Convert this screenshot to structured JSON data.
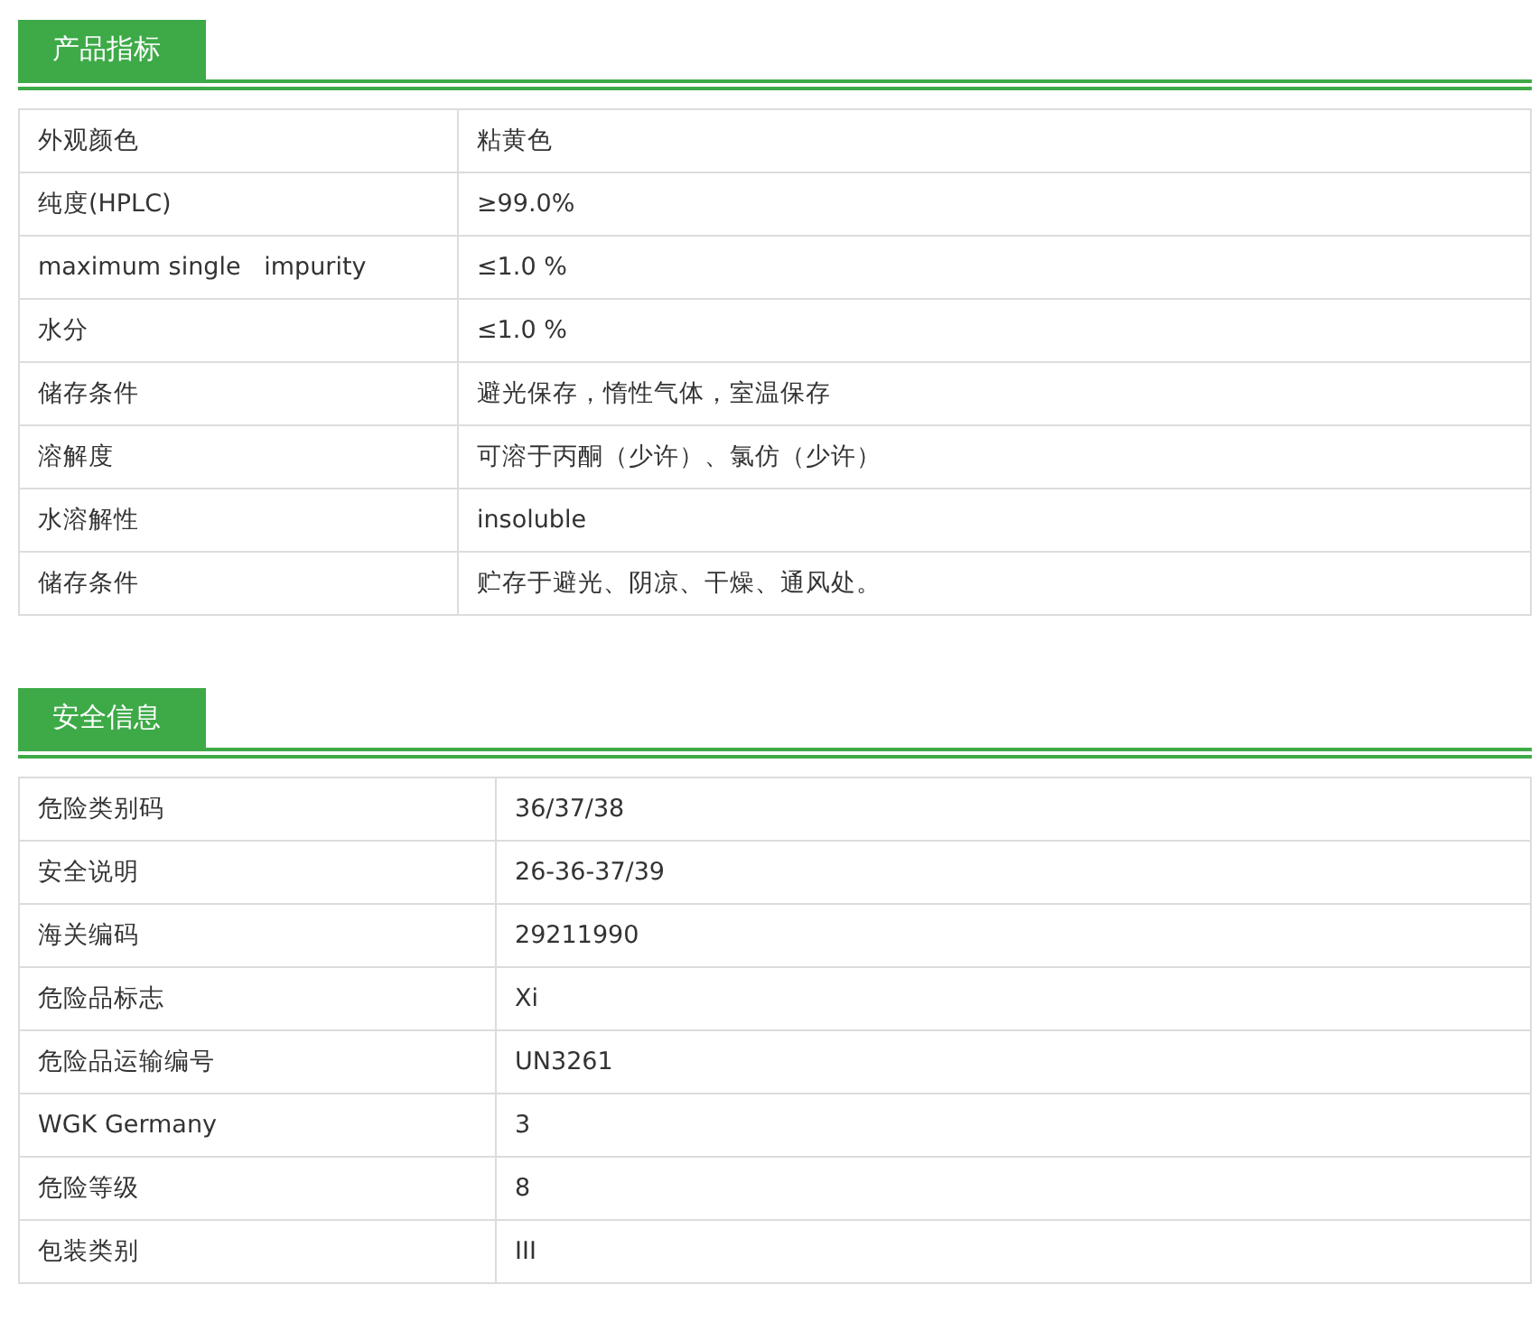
{
  "sections": [
    {
      "title": "产品指标",
      "rows": [
        {
          "label": "外观颜色",
          "value": "粘黄色"
        },
        {
          "label": "纯度(HPLC)",
          "value": "≥99.0%"
        },
        {
          "label": "maximum single   impurity",
          "value": "≤1.0 %"
        },
        {
          "label": "水分",
          "value": "≤1.0 %"
        },
        {
          "label": "储存条件",
          "value": "避光保存，惰性气体，室温保存"
        },
        {
          "label": "溶解度",
          "value": "可溶于丙酮（少许）、氯仿（少许）"
        },
        {
          "label": "水溶解性",
          "value": "insoluble"
        },
        {
          "label": "储存条件",
          "value": "贮存于避光、阴凉、干燥、通风处。"
        }
      ]
    },
    {
      "title": "安全信息",
      "rows": [
        {
          "label": "危险类别码",
          "value": "36/37/38"
        },
        {
          "label": "安全说明",
          "value": "26-36-37/39"
        },
        {
          "label": "海关编码",
          "value": "29211990"
        },
        {
          "label": "危险品标志",
          "value": "Xi"
        },
        {
          "label": "危险品运输编号",
          "value": "UN3261"
        },
        {
          "label": "WGK Germany",
          "value": "3"
        },
        {
          "label": "危险等级",
          "value": "8"
        },
        {
          "label": "包装类别",
          "value": "III"
        }
      ]
    }
  ]
}
